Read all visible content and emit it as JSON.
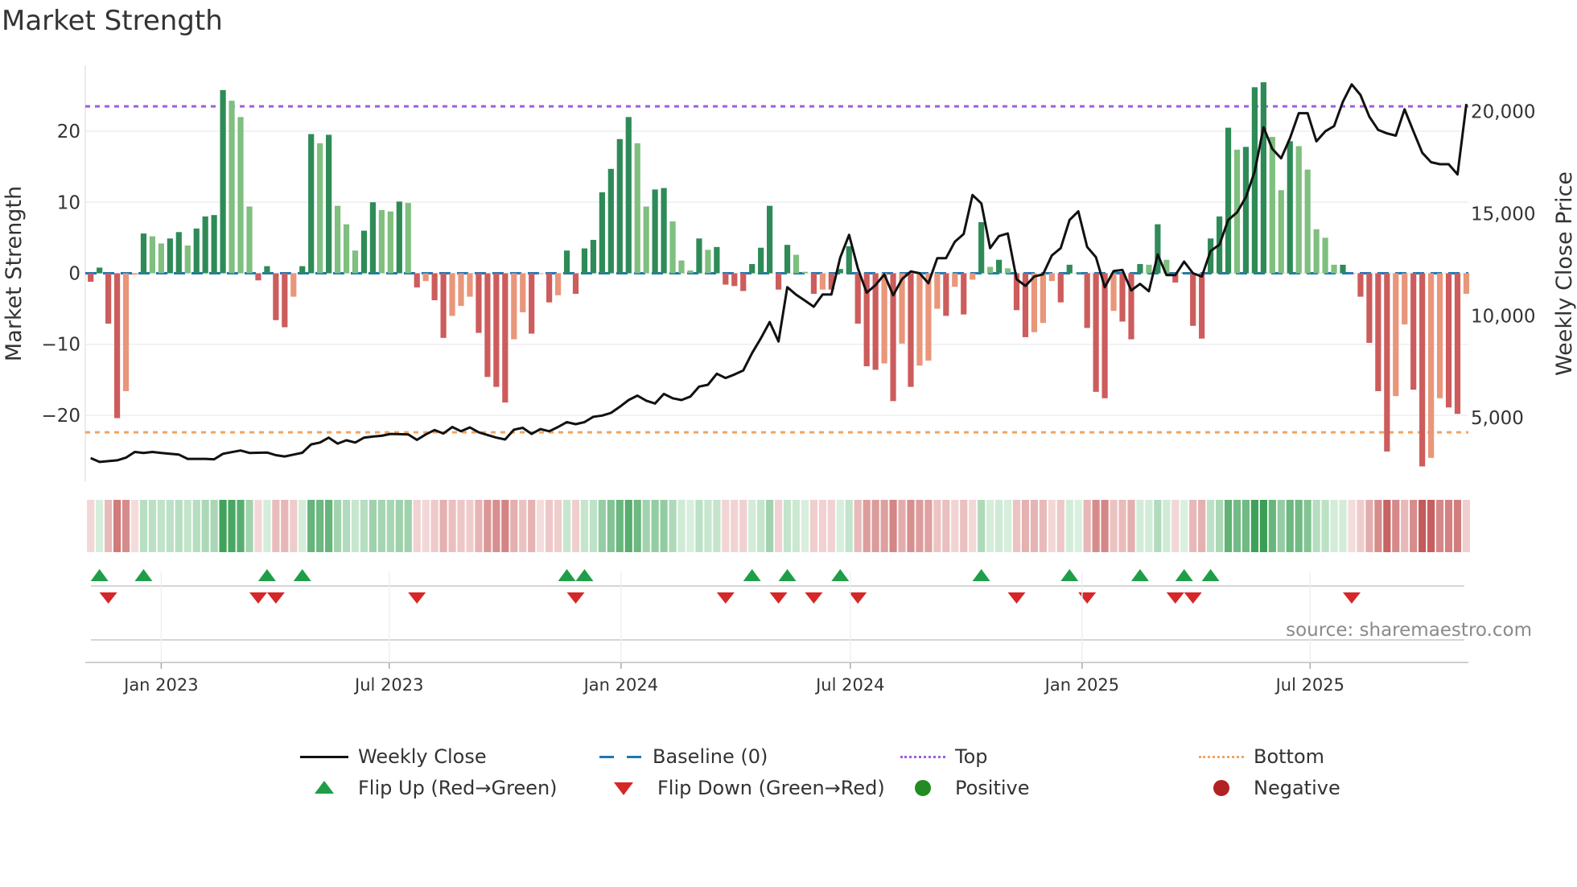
{
  "title": "Market Strength",
  "source": "source: sharemaestro.com",
  "legend": {
    "weekly_close": "Weekly Close",
    "baseline": "Baseline (0)",
    "top": "Top",
    "bottom": "Bottom",
    "flip_up": "Flip Up (Red→Green)",
    "flip_down": "Flip Down (Green→Red)",
    "positive": "Positive",
    "negative": "Negative"
  },
  "colors": {
    "strong_green": "#2e8b57",
    "weak_green": "#7fbf7f",
    "strong_red": "#cd5c5c",
    "weak_red": "#e9967a",
    "price_line": "#111111",
    "baseline": "#1f77b4",
    "top": "#9b5fe0",
    "bottom": "#f4a460",
    "flip_up": "#1e9e48",
    "flip_down": "#d62728",
    "positive": "#228b22",
    "negative": "#b22222"
  },
  "chart_data": {
    "type": "bar",
    "title": "Market Strength",
    "ylabel": "Market Strength",
    "y2label": "Weekly Close Price",
    "ylim": [
      -29.3,
      29.3
    ],
    "y2lim": [
      1890,
      22270
    ],
    "yticks": [
      20,
      10,
      0,
      -10,
      -20
    ],
    "ytick_labels": [
      "20",
      "10",
      "0",
      "−10",
      "−20"
    ],
    "y2ticks": [
      20000,
      15000,
      10000,
      5000
    ],
    "y2tick_labels": [
      "20,000",
      "15,000",
      "10,000",
      "5,000"
    ],
    "xticks": [
      "2023-01-01",
      "2023-07-01",
      "2024-01-01",
      "2024-07-01",
      "2025-01-01",
      "2025-07-01"
    ],
    "xtick_labels": [
      "Jan 2023",
      "Jul 2023",
      "Jan 2024",
      "Jul 2024",
      "Jan 2025",
      "Jul 2025"
    ],
    "grid": true,
    "legend_position": "bottom",
    "top_level": 23.5,
    "bottom_level": -22.4,
    "baseline_level": 0,
    "dates": [
      "2022-11-06",
      "2022-11-13",
      "2022-11-20",
      "2022-11-27",
      "2022-12-04",
      "2022-12-11",
      "2022-12-18",
      "2022-12-25",
      "2023-01-01",
      "2023-01-08",
      "2023-01-15",
      "2023-01-22",
      "2023-01-29",
      "2023-02-05",
      "2023-02-12",
      "2023-02-19",
      "2023-02-26",
      "2023-03-05",
      "2023-03-12",
      "2023-03-19",
      "2023-03-26",
      "2023-04-02",
      "2023-04-09",
      "2023-04-16",
      "2023-04-23",
      "2023-04-30",
      "2023-05-07",
      "2023-05-14",
      "2023-05-21",
      "2023-05-28",
      "2023-06-04",
      "2023-06-11",
      "2023-06-18",
      "2023-06-25",
      "2023-07-02",
      "2023-07-09",
      "2023-07-16",
      "2023-07-23",
      "2023-07-30",
      "2023-08-06",
      "2023-08-13",
      "2023-08-20",
      "2023-08-27",
      "2023-09-03",
      "2023-09-10",
      "2023-09-17",
      "2023-09-24",
      "2023-10-01",
      "2023-10-08",
      "2023-10-15",
      "2023-10-22",
      "2023-10-29",
      "2023-11-05",
      "2023-11-12",
      "2023-11-19",
      "2023-11-26",
      "2023-12-03",
      "2023-12-10",
      "2023-12-17",
      "2023-12-24",
      "2023-12-31",
      "2024-01-07",
      "2024-01-14",
      "2024-01-21",
      "2024-01-28",
      "2024-02-04",
      "2024-02-11",
      "2024-02-18",
      "2024-02-25",
      "2024-03-03",
      "2024-03-10",
      "2024-03-17",
      "2024-03-24",
      "2024-03-31",
      "2024-04-07",
      "2024-04-14",
      "2024-04-21",
      "2024-04-28",
      "2024-05-05",
      "2024-05-12",
      "2024-05-19",
      "2024-05-26",
      "2024-06-02",
      "2024-06-09",
      "2024-06-16",
      "2024-06-23",
      "2024-06-30",
      "2024-07-07",
      "2024-07-14",
      "2024-07-21",
      "2024-07-28",
      "2024-08-04",
      "2024-08-11",
      "2024-08-18",
      "2024-08-25",
      "2024-09-01",
      "2024-09-08",
      "2024-09-15",
      "2024-09-22",
      "2024-09-29",
      "2024-10-06",
      "2024-10-13",
      "2024-10-20",
      "2024-10-27",
      "2024-11-03",
      "2024-11-10",
      "2024-11-17",
      "2024-11-24",
      "2024-12-01",
      "2024-12-08",
      "2024-12-15",
      "2024-12-22",
      "2024-12-29",
      "2025-01-05",
      "2025-01-12",
      "2025-01-19",
      "2025-01-26",
      "2025-02-02",
      "2025-02-09",
      "2025-02-16",
      "2025-02-23",
      "2025-03-02",
      "2025-03-09",
      "2025-03-16",
      "2025-03-23",
      "2025-03-30",
      "2025-04-06",
      "2025-04-13",
      "2025-04-20",
      "2025-04-27",
      "2025-05-04",
      "2025-05-11",
      "2025-05-18",
      "2025-05-25",
      "2025-06-01",
      "2025-06-08",
      "2025-06-15",
      "2025-06-22",
      "2025-06-29",
      "2025-07-06",
      "2025-07-13",
      "2025-07-20",
      "2025-07-27",
      "2025-08-03",
      "2025-08-10",
      "2025-08-17",
      "2025-08-24",
      "2025-08-31",
      "2025-09-07",
      "2025-09-14",
      "2025-09-21",
      "2025-09-28",
      "2025-10-05",
      "2025-10-12",
      "2025-10-19",
      "2025-10-26",
      "2025-11-02"
    ],
    "series": [
      {
        "name": "Market Strength",
        "type": "bar",
        "values": [
          -1.2,
          0.8,
          -7.1,
          -20.4,
          -16.6,
          -0.2,
          5.6,
          5.2,
          4.2,
          4.9,
          5.8,
          3.9,
          6.3,
          8.0,
          8.2,
          25.8,
          24.3,
          22.0,
          9.4,
          -1.0,
          1.0,
          -6.6,
          -7.6,
          -3.3,
          1.0,
          19.6,
          18.3,
          19.5,
          9.5,
          6.9,
          3.2,
          6.0,
          10.0,
          8.9,
          8.7,
          10.1,
          9.9,
          -2.0,
          -1.1,
          -3.8,
          -9.1,
          -6.0,
          -4.6,
          -3.3,
          -8.4,
          -14.6,
          -16.0,
          -18.2,
          -9.3,
          -5.5,
          -8.5,
          -0.1,
          -4.1,
          -3.1,
          3.2,
          -2.9,
          3.5,
          4.7,
          11.4,
          14.7,
          18.9,
          22.0,
          18.3,
          9.4,
          11.8,
          12.0,
          7.3,
          1.8,
          0.4,
          4.9,
          3.3,
          3.7,
          -1.6,
          -1.8,
          -2.5,
          1.3,
          3.6,
          9.5,
          -2.3,
          4.0,
          2.6,
          0.2,
          -2.9,
          -2.3,
          -2.3,
          0.6,
          3.8,
          -7.1,
          -13.1,
          -13.6,
          -12.7,
          -18.0,
          -9.9,
          -16.0,
          -13.0,
          -12.3,
          -5.0,
          -6.0,
          -1.9,
          -5.8,
          -0.9,
          7.2,
          0.9,
          1.9,
          0.7,
          -5.2,
          -9.0,
          -8.3,
          -7.0,
          -1.1,
          -4.1,
          1.2,
          0.1,
          -7.7,
          -16.7,
          -17.6,
          -5.3,
          -6.8,
          -9.3,
          1.3,
          1.2,
          6.9,
          1.9,
          -1.3,
          0.1,
          -7.4,
          -9.2,
          4.9,
          8.0,
          20.5,
          17.4,
          17.8,
          26.2,
          26.9,
          19.2,
          11.7,
          18.6,
          17.9,
          14.6,
          6.2,
          5.0,
          1.2,
          1.2,
          -0.1,
          -3.3,
          -9.8,
          -16.6,
          -25.1,
          -17.3,
          -7.2,
          -16.4,
          -27.2,
          -26.0,
          -17.6,
          -18.9,
          -19.8,
          -2.9
        ]
      },
      {
        "name": "Weekly Close",
        "type": "line",
        "axis": "right",
        "values": [
          3030,
          2840,
          2880,
          2920,
          3050,
          3330,
          3280,
          3330,
          3280,
          3240,
          3200,
          2990,
          2990,
          2990,
          2970,
          3240,
          3320,
          3400,
          3280,
          3290,
          3300,
          3170,
          3110,
          3200,
          3290,
          3700,
          3790,
          4030,
          3740,
          3900,
          3790,
          4030,
          4080,
          4120,
          4210,
          4200,
          4190,
          3920,
          4190,
          4400,
          4230,
          4550,
          4340,
          4530,
          4290,
          4160,
          4030,
          3940,
          4420,
          4510,
          4210,
          4450,
          4340,
          4550,
          4790,
          4690,
          4790,
          5050,
          5110,
          5240,
          5540,
          5870,
          6090,
          5840,
          5700,
          6170,
          5960,
          5870,
          6040,
          6530,
          6620,
          7160,
          6950,
          7120,
          7320,
          8170,
          8900,
          9690,
          8740,
          11400,
          11030,
          10740,
          10440,
          11040,
          11040,
          12850,
          13960,
          12320,
          11130,
          11500,
          12020,
          11000,
          11790,
          12170,
          12080,
          11590,
          12820,
          12820,
          13630,
          14000,
          15910,
          15500,
          13310,
          13900,
          14030,
          11790,
          11460,
          11920,
          12030,
          12950,
          13310,
          14690,
          15110,
          13370,
          12870,
          11400,
          12190,
          12240,
          11240,
          11560,
          11200,
          13000,
          11990,
          11990,
          12650,
          12080,
          11920,
          13170,
          13480,
          14690,
          15060,
          15810,
          17060,
          19230,
          18170,
          17710,
          18700,
          19920,
          19920,
          18540,
          19030,
          19290,
          20480,
          21330,
          20810,
          19750,
          19100,
          18930,
          18820,
          20110,
          19030,
          17980,
          17520,
          17420,
          17420,
          16920,
          20370
        ]
      }
    ]
  }
}
